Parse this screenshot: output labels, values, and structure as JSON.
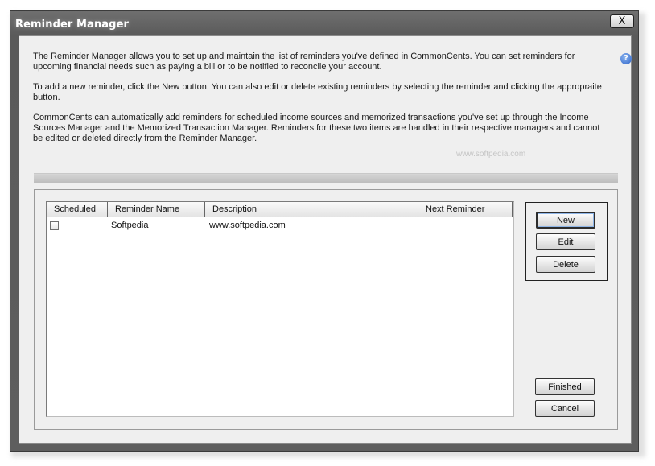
{
  "window": {
    "title": "Reminder Manager",
    "close_glyph": "X"
  },
  "intro": {
    "paragraph1": "The Reminder Manager allows you to set up and maintain the list of reminders you've defined in CommonCents. You can set reminders for upcoming financial needs such as paying a bill or to be notified to reconcile your account.",
    "paragraph2": "To add a new reminder, click the New button. You can also edit or delete existing reminders by selecting the reminder and clicking the appropraite button.",
    "paragraph3": "CommonCents can automatically add reminders for scheduled income sources and memorized transactions you've set up through the Income Sources Manager and the Memorized Transaction Manager. Reminders for these two items are handled in their respective managers and cannot be edited or deleted directly from the Reminder Manager."
  },
  "help_icon": {
    "glyph": "?",
    "icon": "help-icon"
  },
  "watermark": "www.softpedia.com",
  "grid": {
    "columns": [
      "Scheduled",
      "Reminder Name",
      "Description",
      "Next Reminder"
    ],
    "rows": [
      {
        "scheduled": false,
        "name": "Softpedia",
        "description": "www.softpedia.com",
        "next": ""
      }
    ]
  },
  "buttons": {
    "new": "New",
    "edit": "Edit",
    "delete": "Delete",
    "finished": "Finished",
    "cancel": "Cancel"
  }
}
